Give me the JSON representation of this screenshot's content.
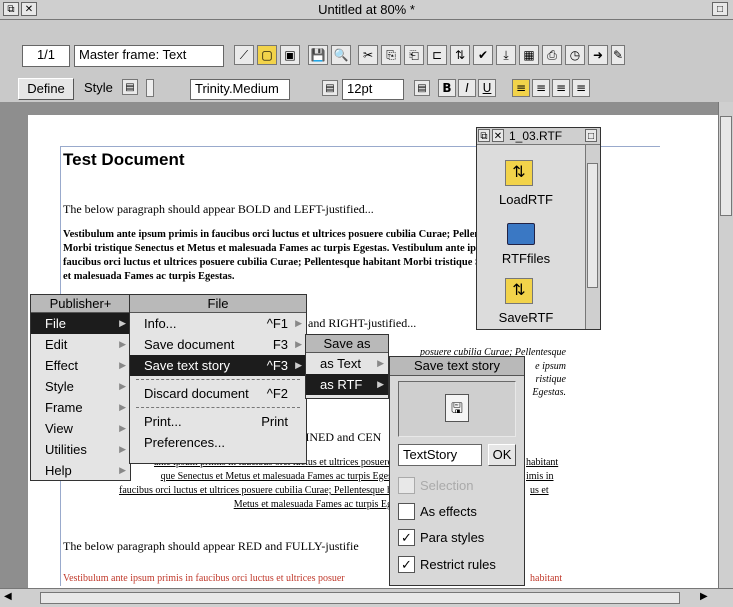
{
  "window": {
    "title": "Untitled at 80% *"
  },
  "toolbar": {
    "page_counter": "1/1",
    "frame_label": "Master frame: Text",
    "define_label": "Define",
    "style_label": "Style",
    "font_name": "Trinity.Medium",
    "font_size": "12pt",
    "bold_label": "B",
    "italic_label": "I",
    "underline_label": "U"
  },
  "document": {
    "heading": "Test Document",
    "para1": "The below paragraph should appear BOLD and LEFT-justified...",
    "bold_para": "Vestibulum ante ipsum primis in faucibus orci luctus et ultrices posuere cubilia Curae; Pellentesque habitant Morbi tristique Senectus et Metus et malesuada Fames ac turpis Egestas. Vestibulum ante ipsum primis in faucibus orci luctus et ultrices posuere cubilia Curae; Pellentesque habitant Morbi tristique Senectus et Metus et malesuada Fames ac turpis Egestas.",
    "para2_tail": "and RIGHT-justified...",
    "right_line1": "posuere cubilia Curae; Pellentesque",
    "right_line2": "e ipsum",
    "right_line3": "ristique",
    "right_line4": "Egestas.",
    "para3_tail": "LINED and CEN",
    "center_line1": "ante ipsum primis in faucibus orci luctus et ultrices posuere",
    "center_line1_tail": "habitant",
    "center_line2": "que Senectus et Metus et malesuada Fames ac turpis Eges",
    "center_line2_tail": "imis in",
    "center_line3": "faucibus orci luctus et ultrices posuere cubilia Curae; Pellentesque h",
    "center_line3_tail": "us et",
    "center_line4": "Metus et malesuada Fames ac turpis Eg",
    "para4": "The below paragraph should appear RED and FULLY-justifie",
    "red_line1": "Vestibulum ante ipsum primis in faucibus orci luctus et ultrices posuer",
    "red_line1_tail": "habitant"
  },
  "rtf_window": {
    "title": "1_03.RTF",
    "items": [
      {
        "label": "LoadRTF"
      },
      {
        "label": "RTFfiles"
      },
      {
        "label": "SaveRTF"
      }
    ]
  },
  "menu_publisher": {
    "title": "Publisher+",
    "items": [
      {
        "label": "File"
      },
      {
        "label": "Edit"
      },
      {
        "label": "Effect"
      },
      {
        "label": "Style"
      },
      {
        "label": "Frame"
      },
      {
        "label": "View"
      },
      {
        "label": "Utilities"
      },
      {
        "label": "Help"
      }
    ]
  },
  "menu_file": {
    "title": "File",
    "items": [
      {
        "label": "Info...",
        "shortcut": "^F1"
      },
      {
        "label": "Save document",
        "shortcut": "F3"
      },
      {
        "label": "Save text story",
        "shortcut": "^F3"
      },
      {
        "label": "Discard document",
        "shortcut": "^F2"
      },
      {
        "label": "Print...",
        "shortcut": "Print"
      },
      {
        "label": "Preferences...",
        "shortcut": ""
      }
    ]
  },
  "menu_saveas": {
    "title": "Save as",
    "items": [
      {
        "label": "as Text"
      },
      {
        "label": "as RTF"
      }
    ]
  },
  "save_dialog": {
    "title": "Save text story",
    "filename": "TextStory",
    "ok_label": "OK",
    "options": [
      {
        "label": "Selection",
        "checked": false,
        "disabled": true
      },
      {
        "label": "As effects",
        "checked": false,
        "disabled": false
      },
      {
        "label": "Para styles",
        "checked": true,
        "disabled": false
      },
      {
        "label": "Restrict rules",
        "checked": true,
        "disabled": false
      }
    ],
    "check_glyph": "✓"
  },
  "colors": {
    "highlight": "#f2d34a",
    "menu_selected": "#1c1c1c",
    "red_text": "#c0392b"
  }
}
